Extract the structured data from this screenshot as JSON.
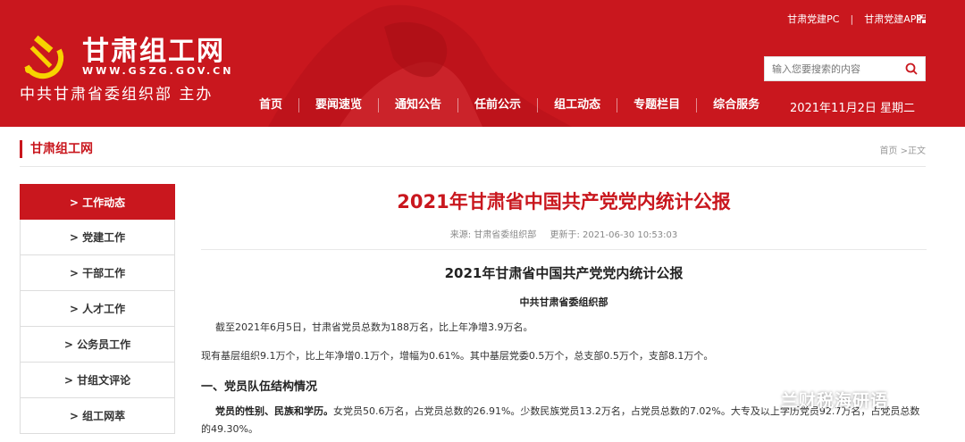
{
  "header": {
    "site_name": "甘肃组工网",
    "site_url": "WWW.GSZG.GOV.CN",
    "sponsor": "中共甘肃省委组织部  主办",
    "top_links": [
      "甘肃党建PC",
      "甘肃党建APP"
    ],
    "top_sep": "|",
    "search_placeholder": "输入您要搜索的内容",
    "nav": [
      "首页",
      "要闻速览",
      "通知公告",
      "任前公示",
      "组工动态",
      "专题栏目",
      "综合服务"
    ],
    "date": "2021年11月2日 星期二"
  },
  "breadcrumb": {
    "section_title": "甘肃组工网",
    "path": "首页 >正文"
  },
  "sidebar": {
    "items": [
      "> 工作动态",
      "> 党建工作",
      "> 干部工作",
      "> 人才工作",
      "> 公务员工作",
      "> 甘组文评论",
      "> 组工网萃"
    ],
    "active_index": 0
  },
  "article": {
    "title": "2021年甘肃省中国共产党党内统计公报",
    "source": "来源: 甘肃省委组织部",
    "updated": "更新于: 2021-06-30 10:53:03",
    "subtitle": "2021年甘肃省中国共产党党内统计公报",
    "org": "中共甘肃省委组织部",
    "p1": "截至2021年6月5日，甘肃省党员总数为188万名，比上年净增3.9万名。",
    "p2": "现有基层组织9.1万个，比上年净增0.1万个，增幅为0.61%。其中基层党委0.5万个，总支部0.5万个，支部8.1万个。",
    "h1": "一、党员队伍结构情况",
    "p3_bold": "党员的性别、民族和学历。",
    "p3_text": "女党员50.6万名，占党员总数的26.91%。少数民族党员13.2万名，占党员总数的7.02%。大专及以上学历党员92.7万名，占党员总数的49.30%。"
  },
  "watermark": "兰财税海研语",
  "colors": {
    "brand_red": "#c9171e",
    "text": "#333333",
    "muted": "#999999"
  }
}
